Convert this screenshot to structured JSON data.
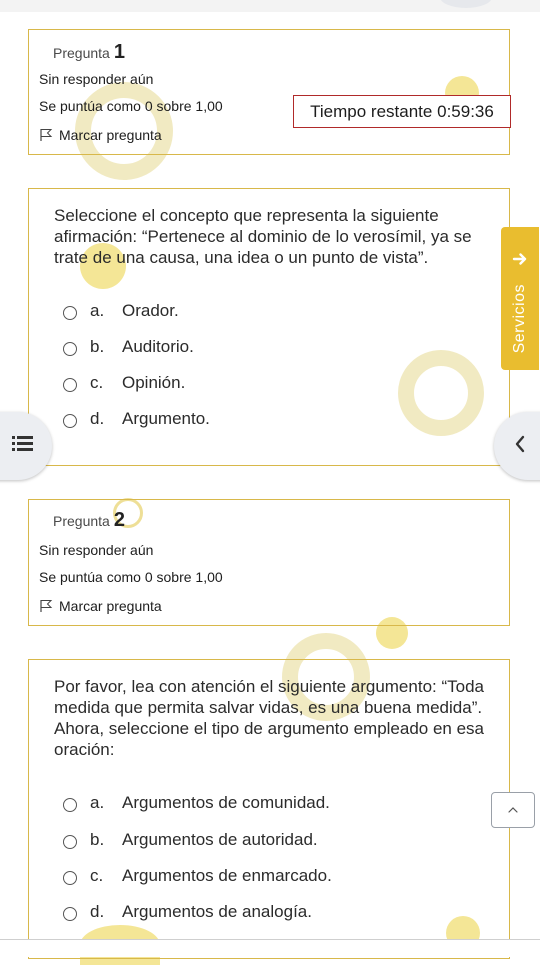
{
  "question1": {
    "prefix": "Pregunta",
    "number": "1",
    "status": "Sin responder aún",
    "score": "Se puntúa como 0 sobre 1,00",
    "flag_label": "Marcar pregunta",
    "text": "Seleccione el concepto que representa la siguiente afirmación: “Pertenece al dominio de lo verosímil, ya se trate de una causa, una idea o un punto de vista”.",
    "options": [
      {
        "letter": "a.",
        "label": "Orador."
      },
      {
        "letter": "b.",
        "label": "Auditorio."
      },
      {
        "letter": "c.",
        "label": "Opinión."
      },
      {
        "letter": "d.",
        "label": "Argumento."
      }
    ]
  },
  "timer": {
    "label": "Tiempo restante",
    "value": "0:59:36"
  },
  "services_tab": {
    "label": "Servicios",
    "icon": "arrow-right-icon"
  },
  "nav": {
    "left_icon": "list-icon",
    "right_icon": "chevron-left-icon",
    "scroll_top_icon": "chevron-up-icon"
  },
  "question2": {
    "prefix": "Pregunta",
    "number": "2",
    "status": "Sin responder aún",
    "score": "Se puntúa como 0 sobre 1,00",
    "flag_label": "Marcar pregunta",
    "text": "Por favor, lea con atención el siguiente argumento: “Toda medida que permita salvar vidas, es una buena medida”. Ahora, seleccione el tipo de argumento empleado en esa oración:",
    "options": [
      {
        "letter": "a.",
        "label": "Argumentos de comunidad."
      },
      {
        "letter": "b.",
        "label": "Argumentos de autoridad."
      },
      {
        "letter": "c.",
        "label": "Argumentos de enmarcado."
      },
      {
        "letter": "d.",
        "label": "Argumentos de analogía."
      }
    ]
  },
  "colors": {
    "card_border": "#d8b84a",
    "timer_border": "#b02a2a",
    "services_bg": "#e9bd2f"
  }
}
